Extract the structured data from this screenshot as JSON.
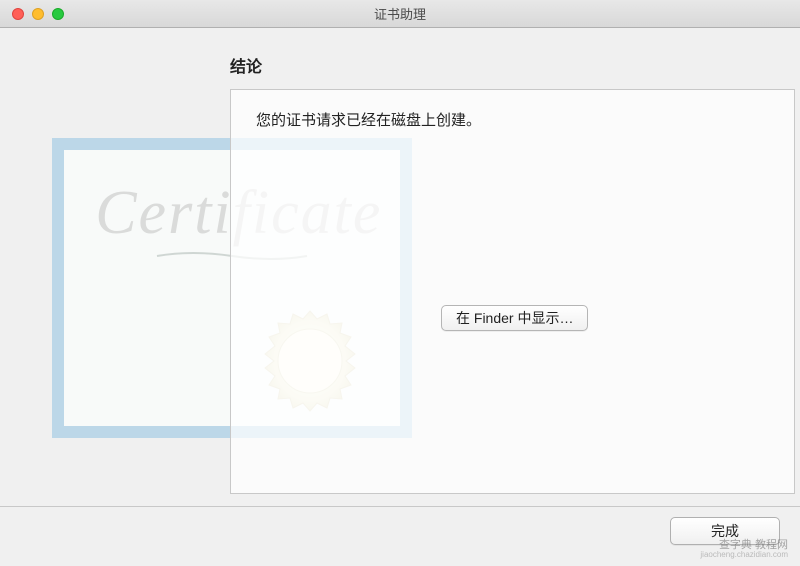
{
  "window": {
    "title": "证书助理"
  },
  "heading": "结论",
  "message": "您的证书请求已经在磁盘上创建。",
  "certificate_decor": {
    "text": "Certificate"
  },
  "buttons": {
    "show_in_finder": "在 Finder 中显示…",
    "done": "完成"
  },
  "watermark": {
    "line1": "查字典 教程网",
    "line2": "jiaocheng.chazidian.com"
  }
}
